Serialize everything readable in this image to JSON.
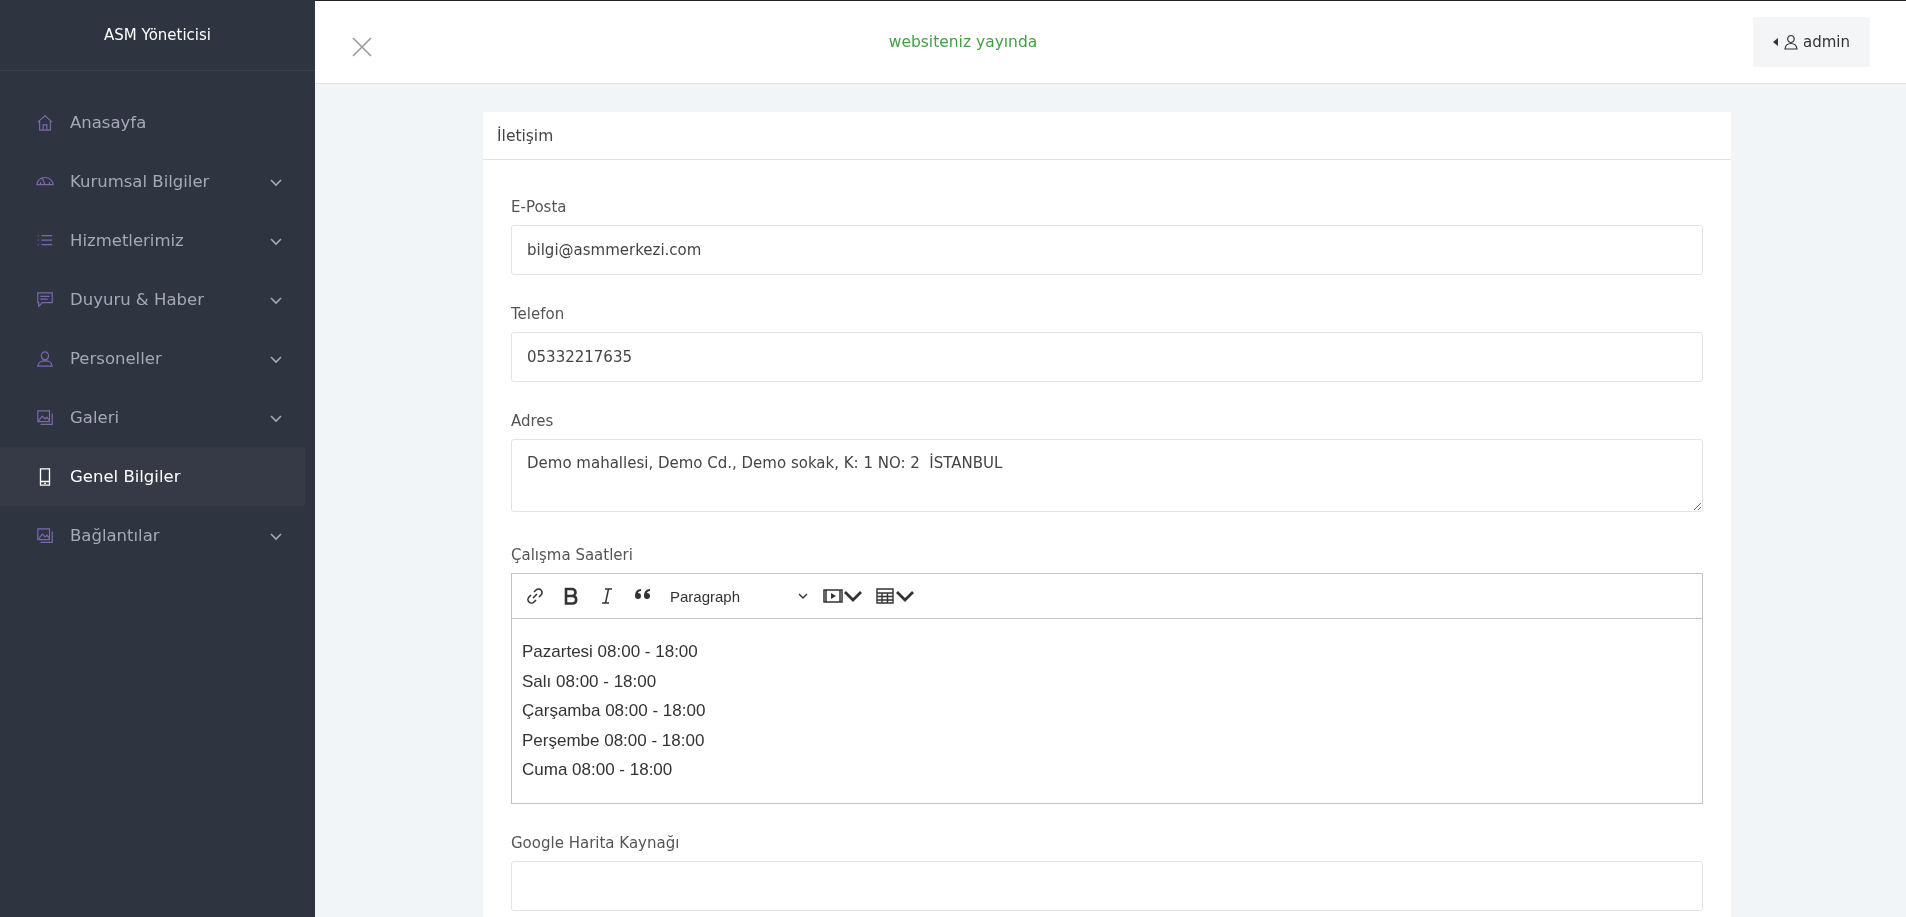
{
  "sidebar": {
    "title": "ASM Yöneticisi",
    "items": [
      {
        "label": "Anasayfa",
        "selected": false
      },
      {
        "label": "Kurumsal Bilgiler",
        "selected": false,
        "expanded": false
      },
      {
        "label": "Hizmetlerimiz",
        "selected": false,
        "expanded": false
      },
      {
        "label": "Duyuru & Haber",
        "selected": false,
        "expanded": false
      },
      {
        "label": "Personeller",
        "selected": false,
        "expanded": false
      },
      {
        "label": "Galeri",
        "selected": false,
        "expanded": false
      },
      {
        "label": "Genel Bilgiler",
        "selected": true
      },
      {
        "label": "Bağlantılar",
        "selected": false,
        "expanded": false
      }
    ]
  },
  "topbar": {
    "status": "websiteniz yayında",
    "user": "admin"
  },
  "card": {
    "title": "İletişim",
    "fields": [
      {
        "kind": "input",
        "label": "E-Posta",
        "value": "bilgi@asmmerkezi.com"
      },
      {
        "kind": "input",
        "label": "Telefon",
        "value": "05332217635"
      },
      {
        "kind": "textarea",
        "label": "Adres",
        "value": "Demo mahallesi, Demo Cd., Demo sokak, K: 1 NO: 2  İSTANBUL"
      },
      {
        "kind": "editor",
        "label": "Çalışma Saatleri",
        "block_format": "Paragraph",
        "lines": [
          "Pazartesi 08:00 - 18:00",
          "Salı 08:00 - 18:00",
          "Çarşamba 08:00 - 18:00",
          "Perşembe 08:00 - 18:00",
          "Cuma 08:00 - 18:00"
        ]
      },
      {
        "kind": "input",
        "label": "Google Harita Kaynağı"
      }
    ]
  }
}
